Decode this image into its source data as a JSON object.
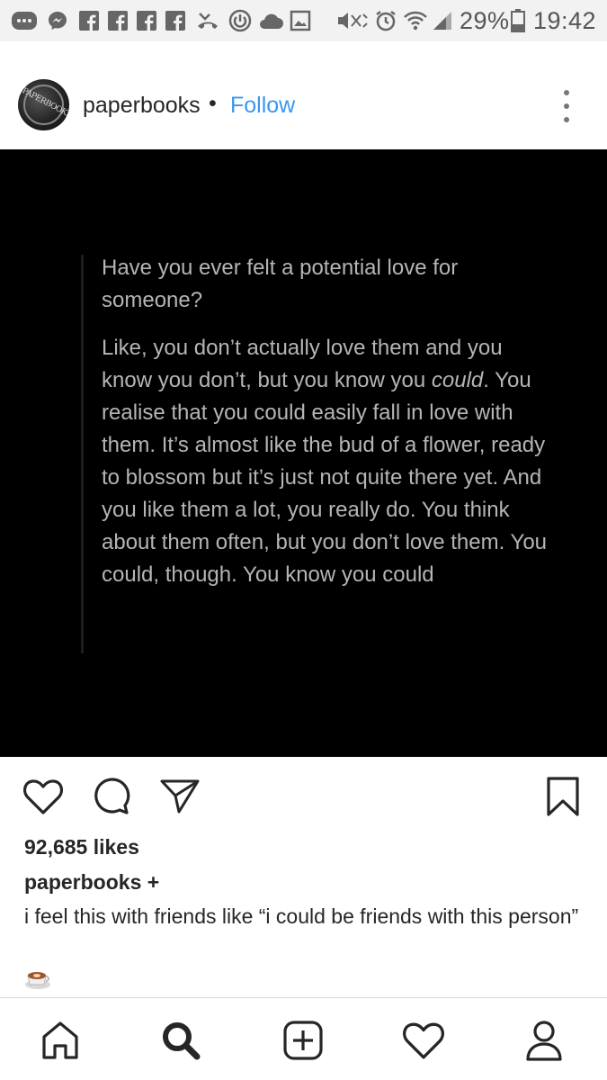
{
  "status_bar": {
    "battery_percent": "29%",
    "time": "19:42"
  },
  "post": {
    "avatar_text": "PAPERBOOKS",
    "username": "paperbooks",
    "separator": "•",
    "follow_label": "Follow",
    "quote_paragraph_1": "Have you ever felt a potential love for someone?",
    "quote_paragraph_2_before": "Like, you don’t actually love them and you know you don’t, but you know you ",
    "quote_paragraph_2_emphasis": "could",
    "quote_paragraph_2_after": ". You realise that you could easily fall in love with them. It’s almost like the bud of a flower, ready to blossom but it’s just not quite there yet. And you like them a lot, you really do. You think about them often, but you don’t love them. You could, though. You know you could",
    "likes": "92,685 likes",
    "caption_user": "paperbooks +",
    "caption_text": "i feel this with friends like “i could be friends with this person”"
  },
  "icons": {
    "like": "heart-icon",
    "comment": "comment-icon",
    "share": "send-icon",
    "save": "bookmark-icon",
    "nav_home": "home-icon",
    "nav_search": "search-icon",
    "nav_add": "add-post-icon",
    "nav_activity": "heart-icon",
    "nav_profile": "profile-icon"
  },
  "colors": {
    "accent": "#3897f0",
    "text": "#262626",
    "image_bg": "#000000",
    "quote_text": "#b5b5b5"
  }
}
